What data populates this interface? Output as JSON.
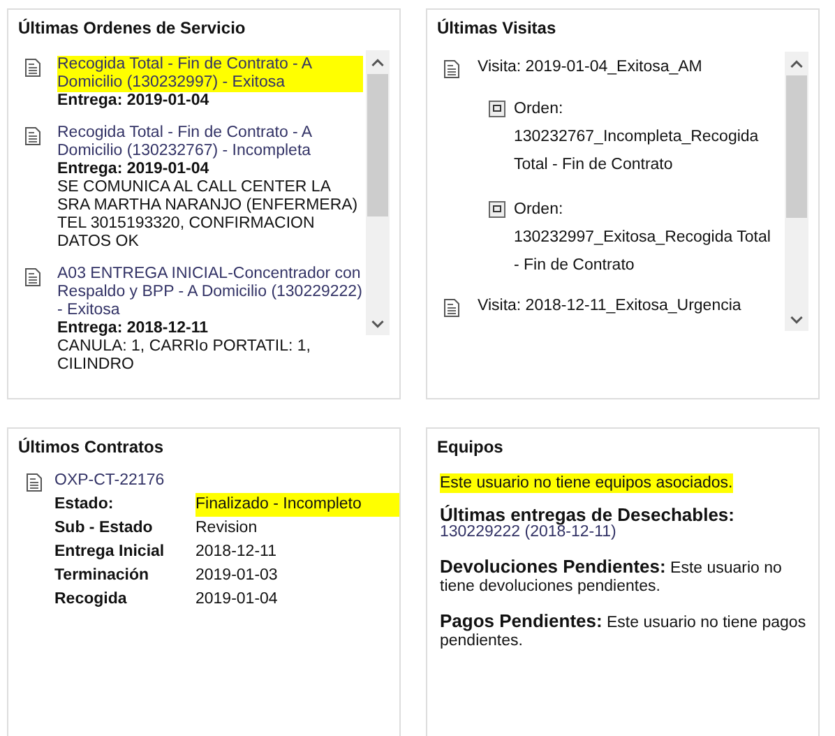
{
  "orders_panel": {
    "title": "Últimas Ordenes de Servicio",
    "orders": [
      {
        "title": "Recogida Total - Fin de Contrato - A Domicilio (130232997) - Exitosa",
        "highlighted": true,
        "delivery": "Entrega: 2019-01-04"
      },
      {
        "title": "Recogida Total - Fin de Contrato - A Domicilio (130232767) - Incompleta",
        "highlighted": false,
        "delivery": "Entrega: 2019-01-04",
        "note": "SE COMUNICA AL CALL CENTER LA SRA MARTHA NARANJO (ENFERMERA) TEL 3015193320, CONFIRMACION DATOS OK"
      },
      {
        "title": "A03 ENTREGA INICIAL-Concentrador con Respaldo y BPP - A Domicilio (130229222) - Exitosa",
        "highlighted": false,
        "delivery": "Entrega: 2018-12-11",
        "note": "CANULA: 1, CARRIo PORTATIL: 1, CILINDRO"
      }
    ]
  },
  "visits_panel": {
    "title": "Últimas Visitas",
    "visits": [
      {
        "label": "Visita: 2019-01-04_Exitosa_AM",
        "orders": [
          "Orden: 130232767_Incompleta_Recogida Total - Fin de Contrato",
          "Orden: 130232997_Exitosa_Recogida Total - Fin de Contrato"
        ]
      },
      {
        "label": "Visita: 2018-12-11_Exitosa_Urgencia"
      }
    ]
  },
  "contracts_panel": {
    "title": "Últimos Contratos",
    "contracts": [
      {
        "id": "OXP-CT-22176",
        "fields": [
          {
            "label": "Estado:",
            "value": "Finalizado - Incompleto",
            "highlighted": true
          },
          {
            "label": "Sub - Estado",
            "value": "Revision",
            "highlighted": false
          },
          {
            "label": "Entrega Inicial",
            "value": "2018-12-11",
            "highlighted": false
          },
          {
            "label": "Terminación",
            "value": "2019-01-03",
            "highlighted": false
          },
          {
            "label": "Recogida",
            "value": "2019-01-04",
            "highlighted": false
          }
        ]
      }
    ]
  },
  "equipment_panel": {
    "title": "Equipos",
    "message": {
      "text": "Este usuario no tiene equipos asociados.",
      "highlighted": true
    },
    "sections": [
      {
        "kind": "block",
        "heading": "Últimas entregas de Desechables:",
        "text": "130229222 (2018-12-11)"
      },
      {
        "kind": "inline",
        "text": "**Devoluciones Pendientes:** Este usuario no tiene devoluciones pendientes."
      },
      {
        "kind": "inline",
        "text": "**Pagos Pendientes:** Este usuario no tiene pagos pendientes."
      }
    ]
  }
}
